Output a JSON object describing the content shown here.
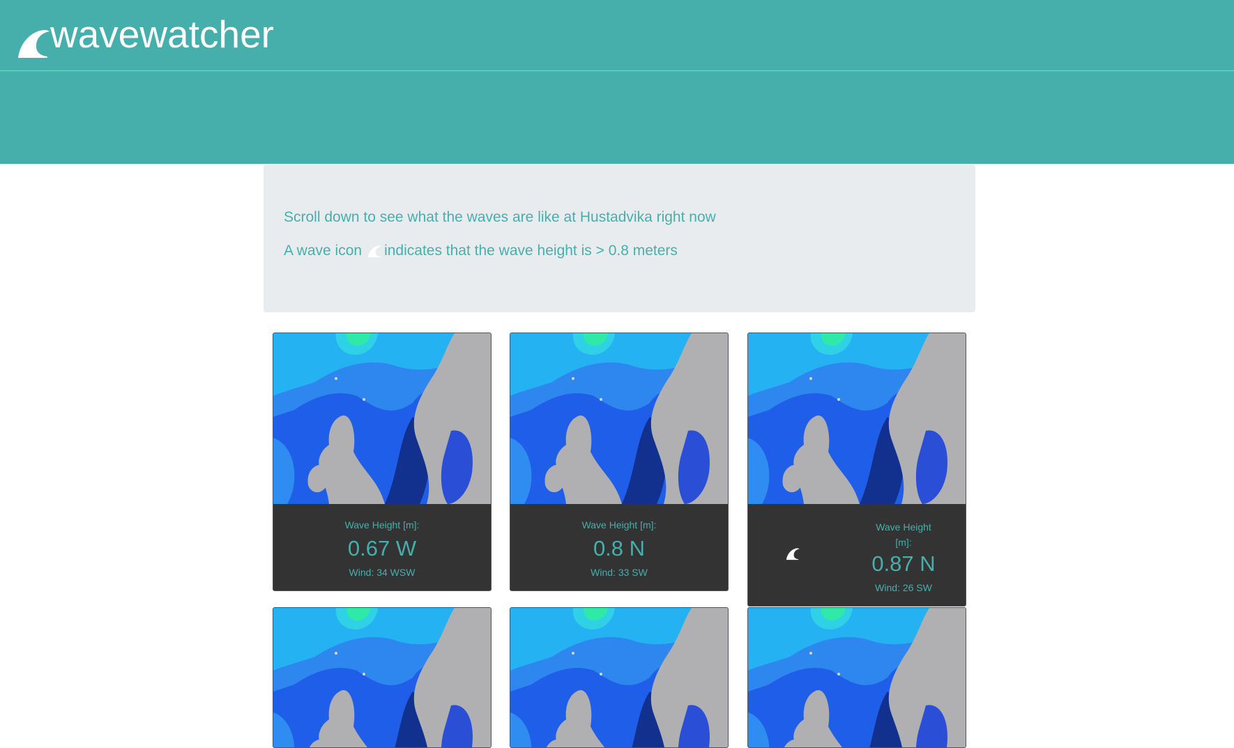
{
  "header": {
    "app_title": "wavewatcher",
    "logo_icon": "wave-icon",
    "color": "#47afab"
  },
  "intro": {
    "line1": "Scroll down to see what the waves are like at Hustadvika right now",
    "line2_before": "A wave icon",
    "line2_after": "indicates that the wave height is > 0.8 meters",
    "icon": "wave-icon"
  },
  "cards": [
    {
      "label": "Wave Height [m]:",
      "value": "0.67 W",
      "wind": "Wind: 34 WSW",
      "high_wave": false
    },
    {
      "label": "Wave Height [m]:",
      "value": "0.8 N",
      "wind": "Wind: 33 SW",
      "high_wave": false
    },
    {
      "label": "Wave Height [m]:",
      "value": "0.87 N",
      "wind": "Wind: 26 SW",
      "high_wave": true
    },
    {
      "high_wave": false
    },
    {
      "high_wave": false
    },
    {
      "high_wave": false
    }
  ]
}
